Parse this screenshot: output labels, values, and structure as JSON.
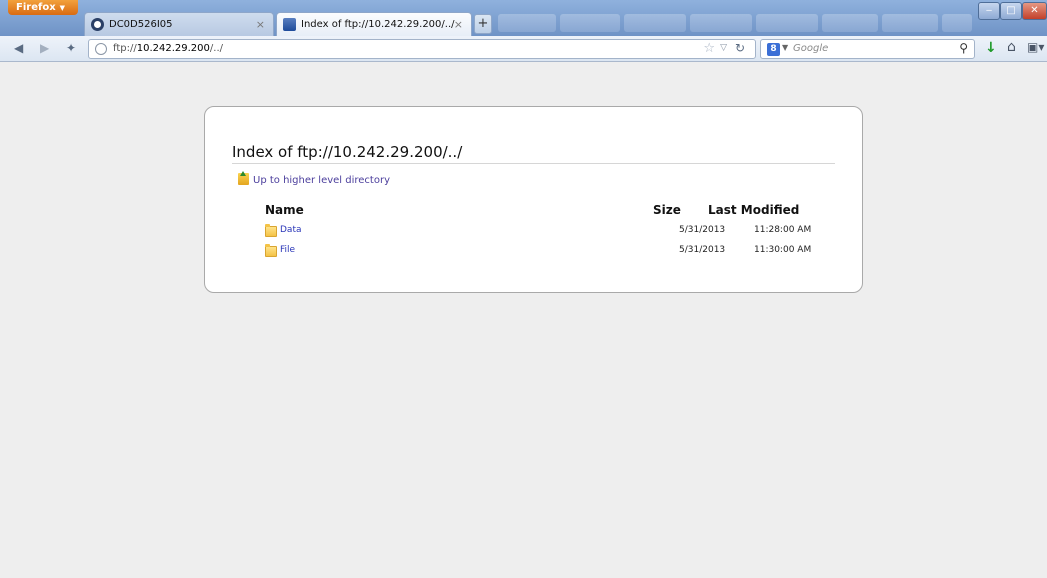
{
  "browser": {
    "menu_button": "Firefox",
    "tabs": [
      {
        "label": "DC0D526I05",
        "active": false
      },
      {
        "label": "Index of ftp://10.242.29.200/../",
        "active": true
      }
    ],
    "new_tab": "+",
    "close_tab": "×"
  },
  "navbar": {
    "url_prefix": "ftp://",
    "url_host": "10.242.29.200",
    "url_path": "/../",
    "search_engine": "8",
    "search_placeholder": "Google"
  },
  "page": {
    "title": "Index of ftp://10.242.29.200/../",
    "up_link": "Up to higher level directory",
    "columns": {
      "name": "Name",
      "size": "Size",
      "modified": "Last Modified"
    },
    "entries": [
      {
        "name": "Data",
        "date": "5/31/2013",
        "time": "11:28:00 AM"
      },
      {
        "name": "File",
        "date": "5/31/2013",
        "time": "11:30:00 AM"
      }
    ]
  },
  "colors": {
    "link": "#2a36b8",
    "visited_link": "#4b3e9c",
    "page_bg": "#eeeeee"
  }
}
